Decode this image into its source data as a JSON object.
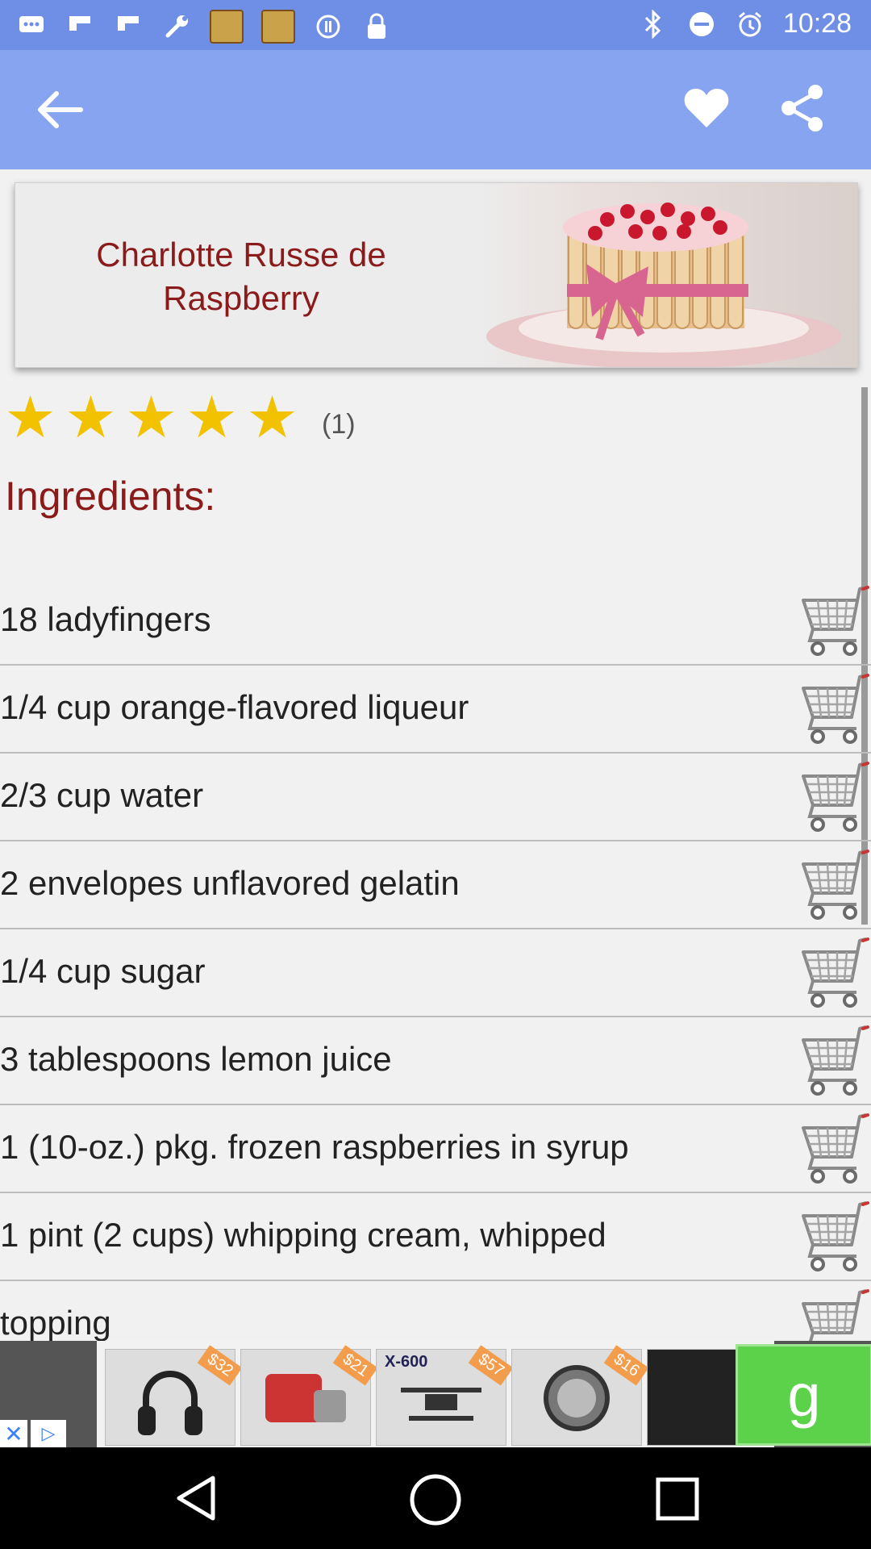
{
  "status_bar": {
    "time": "10:28",
    "left_icons": [
      "chat-icon",
      "flipboard-icon",
      "flipboard-icon",
      "wrench-icon",
      "topics-app-icon",
      "topics-app-icon",
      "circle-pause-icon",
      "lock-icon"
    ],
    "right_icons": [
      "bluetooth-icon",
      "do-not-disturb-icon",
      "alarm-icon"
    ]
  },
  "app_bar": {
    "back_label": "Back",
    "favorite_label": "Favorite",
    "share_label": "Share"
  },
  "recipe": {
    "title": "Charlotte Russe de Raspberry",
    "rating_stars": 5,
    "rating_count": "(1)",
    "ingredients_heading": "Ingredients:",
    "ingredients": [
      "18 ladyfingers",
      "1/4 cup orange-flavored liqueur",
      "2/3 cup water",
      "2 envelopes unflavored gelatin",
      "1/4 cup sugar",
      "3 tablespoons lemon juice",
      "1 (10-oz.) pkg. frozen raspberries in syrup",
      "1 pint (2 cups) whipping cream, whipped",
      "topping"
    ]
  },
  "ad": {
    "tags": [
      "$32",
      "$21",
      "$57",
      "$16"
    ],
    "tile_label": "X-600",
    "button_label": "g"
  },
  "colors": {
    "status_bar": "#6f8ee6",
    "app_bar": "#86a4ef",
    "title_red": "#8b1a1a",
    "star": "#f2c200"
  }
}
